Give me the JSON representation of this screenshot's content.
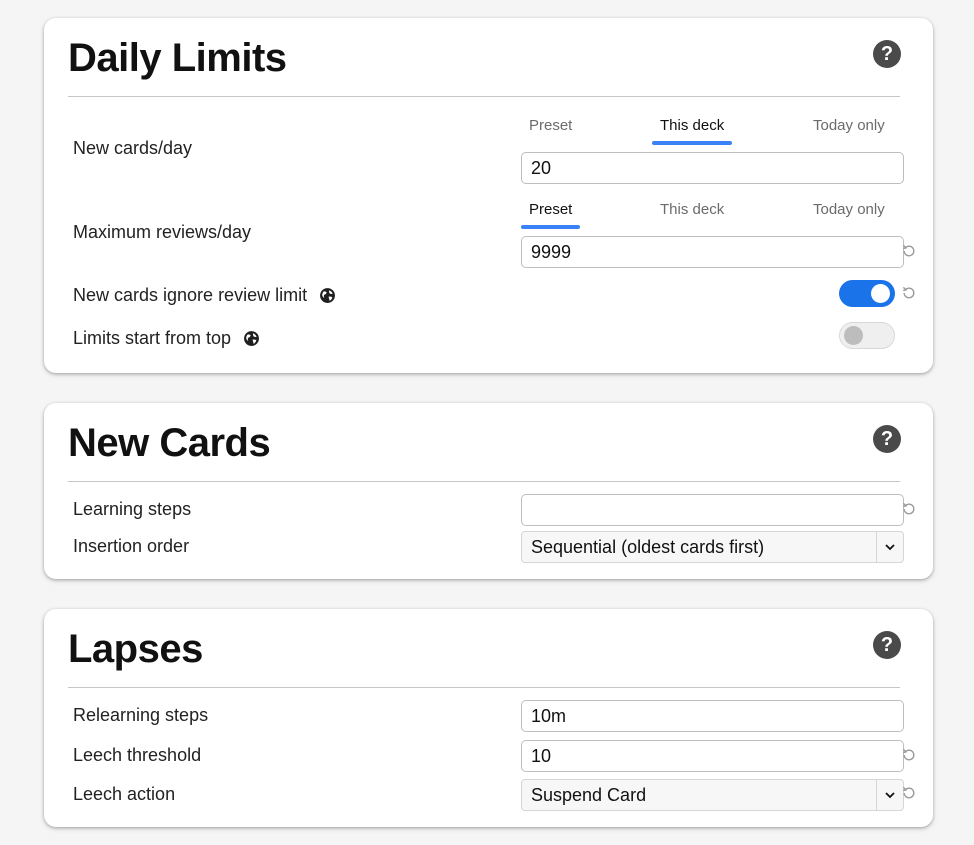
{
  "daily_limits": {
    "title": "Daily Limits",
    "help": "?",
    "new_cards": {
      "label": "New cards/day",
      "tabs": [
        "Preset",
        "This deck",
        "Today only"
      ],
      "active_tab": "This deck",
      "value": "20"
    },
    "max_reviews": {
      "label": "Maximum reviews/day",
      "tabs": [
        "Preset",
        "This deck",
        "Today only"
      ],
      "active_tab": "Preset",
      "value": "9999"
    },
    "ignore_review_limit": {
      "label": "New cards ignore review limit",
      "enabled": true
    },
    "limits_from_top": {
      "label": "Limits start from top",
      "enabled": false
    }
  },
  "new_cards": {
    "title": "New Cards",
    "help": "?",
    "learning_steps": {
      "label": "Learning steps",
      "value": ""
    },
    "insertion_order": {
      "label": "Insertion order",
      "value": "Sequential (oldest cards first)"
    }
  },
  "lapses": {
    "title": "Lapses",
    "help": "?",
    "relearning_steps": {
      "label": "Relearning steps",
      "value": "10m"
    },
    "leech_threshold": {
      "label": "Leech threshold",
      "value": "10"
    },
    "leech_action": {
      "label": "Leech action",
      "value": "Suspend Card"
    }
  },
  "colors": {
    "accent": "#3b82f6",
    "toggle_on": "#1a73e8",
    "help_icon": "#4a4a4a",
    "background": "#f5f5f5"
  },
  "icons": {
    "help": "question-circle-icon",
    "globe": "globe-icon",
    "revert": "revert-icon",
    "select": "chevron-down-icon"
  }
}
